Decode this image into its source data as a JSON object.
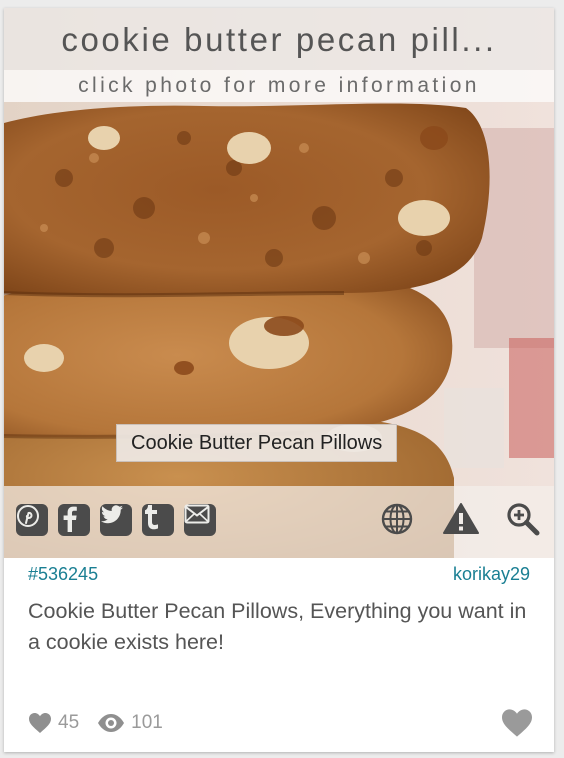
{
  "card": {
    "title": "cookie butter pecan pill...",
    "subtitle": "click photo for more information",
    "photo_caption": "Cookie Butter Pecan Pillows",
    "share": {
      "pinterest_icon": "pinterest-icon",
      "facebook_icon": "facebook-icon",
      "twitter_icon": "twitter-icon",
      "tumblr_icon": "tumblr-icon",
      "email_icon": "email-icon"
    },
    "tools": {
      "globe_icon": "globe-icon",
      "report_icon": "warning-icon",
      "zoom_icon": "zoom-icon"
    },
    "post_id": "#536245",
    "author": "korikay29",
    "description": "Cookie Butter Pecan Pillows, Everything you want in a cookie exists here!",
    "likes": "45",
    "views": "101",
    "colors": {
      "link": "#1a7f93",
      "text": "#555555",
      "stat": "#9a9a9a",
      "icon": "#4b4b4b"
    }
  }
}
